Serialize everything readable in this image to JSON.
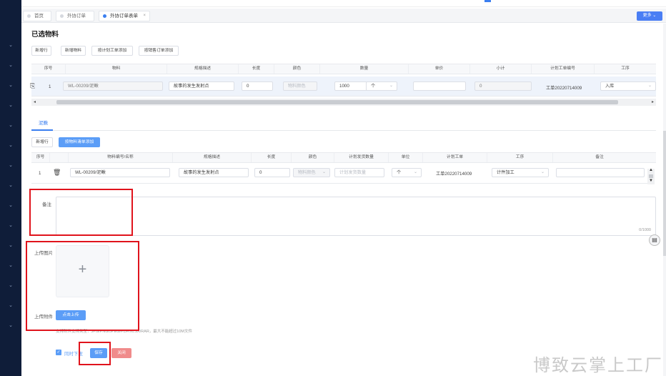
{
  "tabs": [
    {
      "label": "首页",
      "active": false
    },
    {
      "label": "外协订单",
      "active": false
    },
    {
      "label": "外协订单表单",
      "active": true
    }
  ],
  "more_button": "更多 ⌄",
  "section_title": "已选物料",
  "toolbar": {
    "add_row": "新增行",
    "add_material": "新增物料",
    "add_by_plan": "按计划工单添加",
    "add_by_sales": "按销售订单添加"
  },
  "material_table": {
    "headers": [
      "序号",
      "物料",
      "规格描述",
      "长度",
      "颜色",
      "数量",
      "单价",
      "小计",
      "计划工单编号",
      "工序"
    ],
    "row": {
      "index": "1",
      "material": "WL-00209/泥鳅",
      "spec": "故事的发生发射点",
      "length": "0",
      "color_placeholder": "物料颜色",
      "quantity": "1000",
      "unit": "个",
      "price": "",
      "subtotal": "0",
      "plan_order": "工单20220714009",
      "process": "入库"
    }
  },
  "subtab": "泥鳅",
  "sub_toolbar": {
    "add_row": "新增行",
    "add_by_bom": "按物料清单添加"
  },
  "sub_table": {
    "headers": [
      "序号",
      "",
      "物料编号/名称",
      "规格描述",
      "长度",
      "颜色",
      "计划发货数量",
      "单位",
      "计划工单",
      "工序",
      "备注"
    ],
    "row": {
      "index": "1",
      "material": "WL-00209/泥鳅",
      "spec": "故事的发生发射点",
      "length": "0",
      "color_placeholder": "物料颜色",
      "qty_placeholder": "计划发货数量",
      "unit": "个",
      "plan_order": "工单20220714009",
      "process": "计件加工",
      "remark": ""
    }
  },
  "remark_label": "备注",
  "remark_counter": "0/1000",
  "upload_image_label": "上传图片",
  "upload_file_label": "上传附件",
  "upload_button": "点击上传",
  "upload_hint": "支持附件支持类型：JPG/PNG/JPEG/PDF/XLSX/RAR，最大不能超过10M文件",
  "sync_label": "同时下发",
  "save_button": "保存",
  "close_button": "关闭",
  "watermark": "博致云掌上工厂",
  "colors": {
    "primary": "#5b9df7",
    "sidebar": "#0f1d39",
    "highlight": "#e0131c"
  }
}
